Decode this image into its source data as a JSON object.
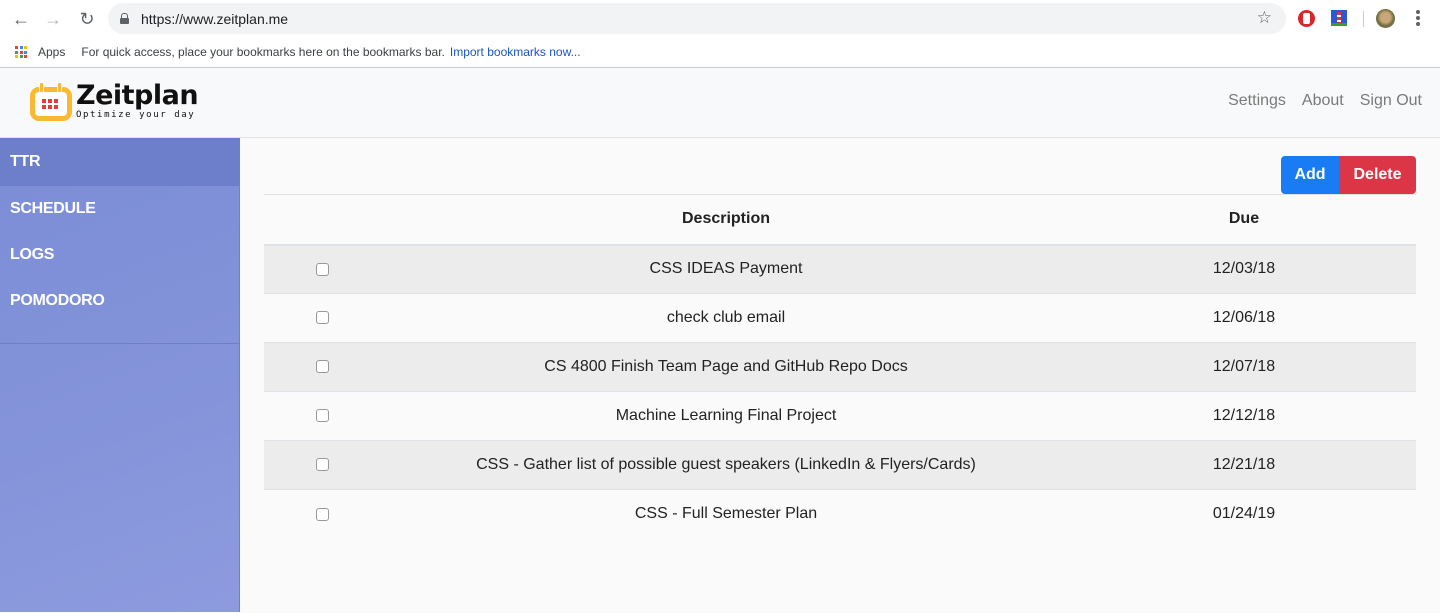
{
  "browser": {
    "url": "https://www.zeitplan.me",
    "bookmarks_bar": {
      "apps_label": "Apps",
      "hint": "For quick access, place your bookmarks here on the bookmarks bar.",
      "import_link": "Import bookmarks now..."
    },
    "icons": [
      "back-arrow-icon",
      "forward-arrow-icon",
      "reload-icon",
      "lock-icon",
      "star-icon",
      "opera-adblock-icon",
      "lighthouse-icon",
      "profile-avatar",
      "menu-dots-icon"
    ]
  },
  "header": {
    "logo_title": "Zeitplan",
    "logo_tagline": "Optimize your day",
    "nav": [
      {
        "label": "Settings"
      },
      {
        "label": "About"
      },
      {
        "label": "Sign Out"
      }
    ]
  },
  "sidebar": {
    "items": [
      {
        "label": "TTR",
        "active": true
      },
      {
        "label": "SCHEDULE",
        "active": false
      },
      {
        "label": "LOGS",
        "active": false
      },
      {
        "label": "POMODORO",
        "active": false
      }
    ]
  },
  "toolbar": {
    "add_label": "Add",
    "delete_label": "Delete"
  },
  "table": {
    "headers": {
      "check": "",
      "description": "Description",
      "due": "Due"
    },
    "rows": [
      {
        "checked": false,
        "description": "CSS IDEAS Payment",
        "due": "12/03/18"
      },
      {
        "checked": false,
        "description": "check club email",
        "due": "12/06/18"
      },
      {
        "checked": false,
        "description": "CS 4800 Finish Team Page and GitHub Repo Docs",
        "due": "12/07/18"
      },
      {
        "checked": false,
        "description": "Machine Learning Final Project",
        "due": "12/12/18"
      },
      {
        "checked": false,
        "description": "CSS - Gather list of possible guest speakers (LinkedIn & Flyers/Cards)",
        "due": "12/21/18"
      },
      {
        "checked": false,
        "description": "CSS - Full Semester Plan",
        "due": "01/24/19"
      }
    ]
  },
  "colors": {
    "sidebar": "#7b8dd6",
    "sidebar_active": "#6d7ecb",
    "add_button": "#1a7cf5",
    "delete_button": "#dc3545",
    "logo_accent": "#f9b932"
  }
}
